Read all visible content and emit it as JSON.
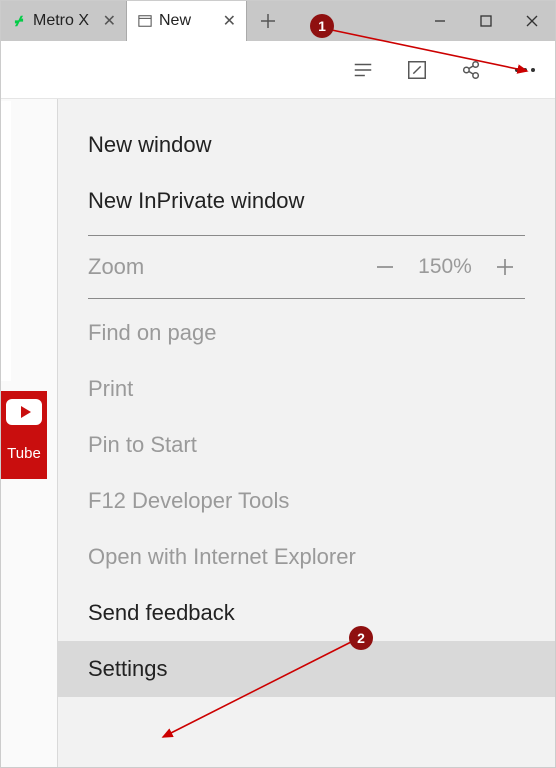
{
  "tabs": {
    "inactive": {
      "title": "Metro X"
    },
    "active": {
      "title": "New"
    }
  },
  "sidebar": {
    "label": "Tube"
  },
  "menu": {
    "new_window": "New window",
    "new_inprivate": "New InPrivate window",
    "zoom_label": "Zoom",
    "zoom_value": "150%",
    "find": "Find on page",
    "print": "Print",
    "pin": "Pin to Start",
    "devtools": "F12 Developer Tools",
    "open_ie": "Open with Internet Explorer",
    "feedback": "Send feedback",
    "settings": "Settings"
  },
  "annotations": {
    "badge1": "1",
    "badge2": "2"
  }
}
